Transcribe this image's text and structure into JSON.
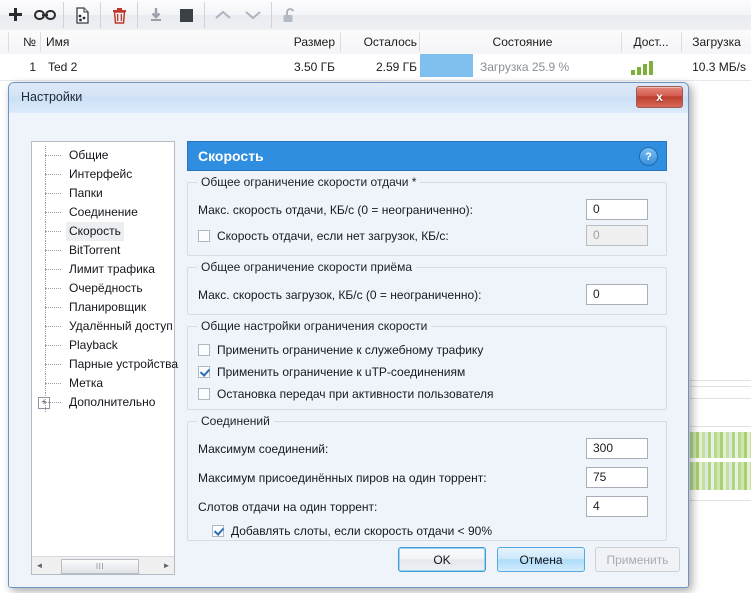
{
  "main_window": {
    "toolbar": {
      "buttons": [
        {
          "name": "add-torrent-icon",
          "glyph": "+"
        },
        {
          "name": "add-url-icon",
          "glyph": "link"
        },
        {
          "name": "create-torrent-icon",
          "glyph": "file"
        },
        {
          "name": "delete-icon",
          "glyph": "trash"
        },
        {
          "name": "start-icon",
          "glyph": "download"
        },
        {
          "name": "stop-icon",
          "glyph": "square"
        },
        {
          "name": "move-up-icon",
          "glyph": "chevron-up"
        },
        {
          "name": "move-down-icon",
          "glyph": "chevron-down"
        },
        {
          "name": "unlock-icon",
          "glyph": "padlock-open"
        }
      ]
    },
    "columns": [
      {
        "key": "num",
        "label": "№"
      },
      {
        "key": "name",
        "label": "Имя"
      },
      {
        "key": "size",
        "label": "Размер"
      },
      {
        "key": "left",
        "label": "Осталось"
      },
      {
        "key": "state",
        "label": "Состояние"
      },
      {
        "key": "avail",
        "label": "Дост..."
      },
      {
        "key": "down",
        "label": "Загрузка"
      }
    ],
    "rows": [
      {
        "num": "1",
        "name": "Ted 2",
        "size": "3.50 ГБ",
        "left": "2.59 ГБ",
        "state": "Загрузка 25.9 %",
        "progress_percent": 25.9,
        "avail_bars": 4,
        "down": "10.3 МБ/s"
      }
    ]
  },
  "dialog": {
    "title": "Настройки",
    "close_label": "x",
    "tree": {
      "items": [
        {
          "label": "Общие",
          "selected": false,
          "expandable": false
        },
        {
          "label": "Интерфейс",
          "selected": false,
          "expandable": false
        },
        {
          "label": "Папки",
          "selected": false,
          "expandable": false
        },
        {
          "label": "Соединение",
          "selected": false,
          "expandable": false
        },
        {
          "label": "Скорость",
          "selected": true,
          "expandable": false
        },
        {
          "label": "BitTorrent",
          "selected": false,
          "expandable": false
        },
        {
          "label": "Лимит трафика",
          "selected": false,
          "expandable": false
        },
        {
          "label": "Очерёдность",
          "selected": false,
          "expandable": false
        },
        {
          "label": "Планировщик",
          "selected": false,
          "expandable": false
        },
        {
          "label": "Удалённый доступ",
          "selected": false,
          "expandable": false
        },
        {
          "label": "Playback",
          "selected": false,
          "expandable": false
        },
        {
          "label": "Парные устройства",
          "selected": false,
          "expandable": false
        },
        {
          "label": "Метка",
          "selected": false,
          "expandable": false
        },
        {
          "label": "Дополнительно",
          "selected": false,
          "expandable": true
        }
      ],
      "expand_glyph": "+",
      "scrollbar": {
        "left_arrow": "◄",
        "right_arrow": "►",
        "grip": "III"
      }
    },
    "pane": {
      "header_title": "Скорость",
      "help_glyph": "?",
      "group_upload": {
        "title": "Общее ограничение скорости отдачи *",
        "max_upload_label": "Макс. скорость отдачи, КБ/с (0 = неограниченно):",
        "max_upload_value": "0",
        "alt_upload_checkbox_label": "Скорость отдачи, если нет загрузок, КБ/с:",
        "alt_upload_checked": false,
        "alt_upload_value": "0",
        "alt_upload_disabled": true
      },
      "group_download": {
        "title": "Общее ограничение скорости приёма",
        "max_download_label": "Макс. скорость загрузок, КБ/с (0 = неограниченно):",
        "max_download_value": "0"
      },
      "group_common": {
        "title": "Общие настройки ограничения скорости",
        "checkboxes": [
          {
            "label": "Применить ограничение к служебному трафику",
            "checked": false
          },
          {
            "label": "Применить ограничение к uTP-соединениям",
            "checked": true
          },
          {
            "label": "Остановка передач при активности пользователя",
            "checked": false
          }
        ]
      },
      "group_connections": {
        "title": "Соединений",
        "max_connections_label": "Максимум соединений:",
        "max_connections_value": "300",
        "max_peers_label": "Максимум присоединённых пиров на один торрент:",
        "max_peers_value": "75",
        "upload_slots_label": "Слотов отдачи на один торрент:",
        "upload_slots_value": "4",
        "auto_slots_label": "Добавлять слоты, если скорость отдачи < 90%",
        "auto_slots_checked": true
      }
    },
    "footer": {
      "ok_label": "OK",
      "cancel_label": "Отмена",
      "apply_label": "Применить"
    }
  },
  "colors": {
    "accent_blue": "#2f8ee0",
    "progress_blue": "#7fc0ef",
    "availability_green": "#7cb03a",
    "close_red": "#bc3d2c",
    "titlebar_blue": "#d3e3f6"
  }
}
